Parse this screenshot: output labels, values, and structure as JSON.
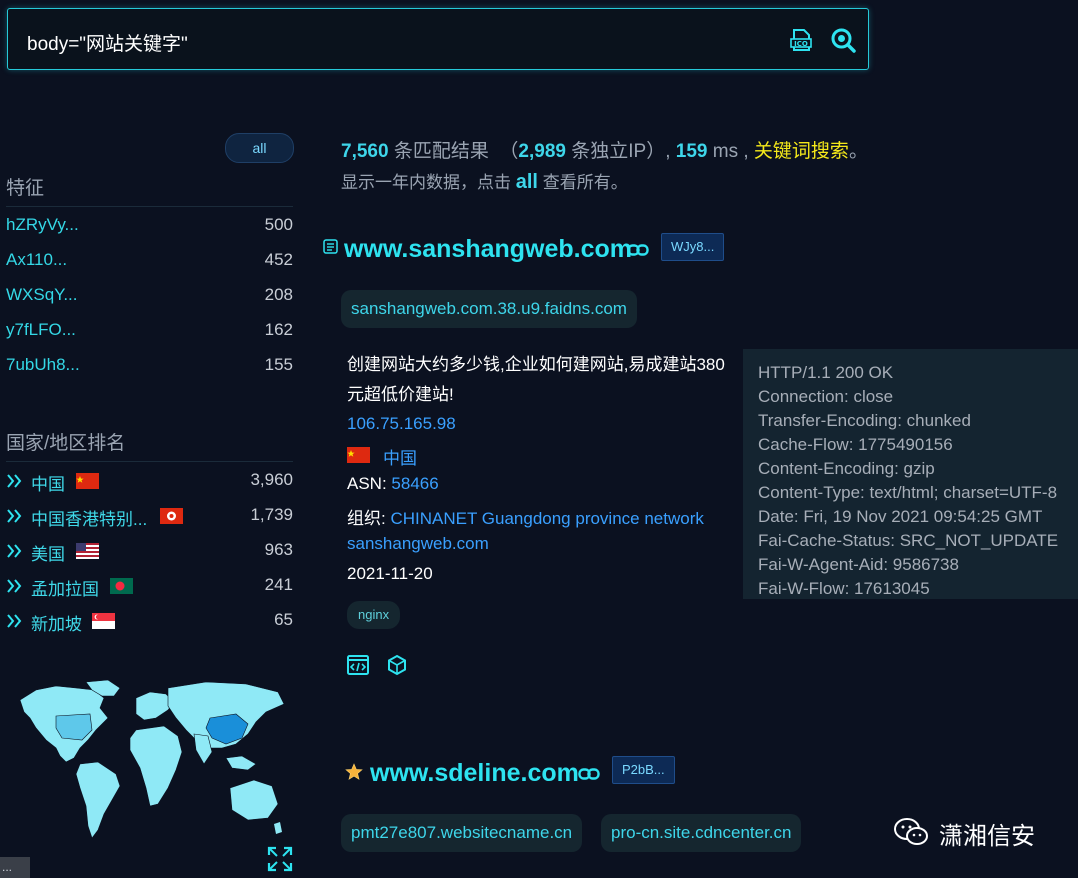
{
  "search": {
    "query": "body=\"网站关键字\""
  },
  "sidebar": {
    "all_label": "all",
    "features_title": "特征",
    "features": [
      {
        "key": "hZRyVy...",
        "count": "500"
      },
      {
        "key": "Ax110...",
        "count": "452"
      },
      {
        "key": "WXSqY...",
        "count": "208"
      },
      {
        "key": "y7fLFO...",
        "count": "162"
      },
      {
        "key": "7ubUh8...",
        "count": "155"
      }
    ],
    "countries_title": "国家/地区排名",
    "countries": [
      {
        "name": "中国",
        "count": "3,960",
        "flag": "cn"
      },
      {
        "name": "中国香港特别...",
        "count": "1,739",
        "flag": "hk"
      },
      {
        "name": "美国",
        "count": "963",
        "flag": "us"
      },
      {
        "name": "孟加拉国",
        "count": "241",
        "flag": "bd"
      },
      {
        "name": "新加坡",
        "count": "65",
        "flag": "sg"
      }
    ],
    "corner_label": "..."
  },
  "summary": {
    "total": "7,560",
    "total_suffix": "条匹配结果",
    "ip_open": "（",
    "unique_ip": "2,989",
    "ip_suffix": "条独立IP）,",
    "ms": "159",
    "ms_suffix": "ms ,",
    "keyword_search": "关键词搜索",
    "end": "。",
    "line2_prefix": "显示一年内数据，点击",
    "line2_all": "all",
    "line2_suffix": "查看所有。"
  },
  "results": [
    {
      "domain": "www.sanshangweb.com",
      "code": "WJy8...",
      "hosts": [
        "sanshangweb.com.38.u9.faidns.com"
      ],
      "title": "创建网站大约多少钱,企业如何建网站,易成建站380元超低价建站!",
      "ip": "106.75.165.98",
      "country": "中国",
      "asn_label": "ASN:",
      "asn": "58466",
      "org_label": "组织:",
      "org": "CHINANET Guangdong province network",
      "site": "sanshangweb.com",
      "date": "2021-11-20",
      "tag": "nginx",
      "http_header": [
        "HTTP/1.1 200 OK",
        "Connection: close",
        "Transfer-Encoding: chunked",
        "Cache-Flow: 1775490156",
        "Content-Encoding: gzip",
        "Content-Type: text/html; charset=UTF-8",
        "Date: Fri, 19 Nov 2021 09:54:25 GMT",
        "Fai-Cache-Status: SRC_NOT_UPDATE",
        "Fai-W-Agent-Aid: 9586738",
        "Fai-W-Flow: 17613045"
      ]
    },
    {
      "domain": "www.sdeline.com",
      "code": "P2bB...",
      "hosts": [
        "pmt27e807.websitecname.cn",
        "pro-cn.site.cdncenter.cn"
      ]
    }
  ],
  "watermark": "潇湘信安",
  "colors": {
    "accent": "#2ee3f0",
    "keyword": "#f5e91a",
    "link": "#3aa0ff",
    "background": "#0b1120"
  }
}
